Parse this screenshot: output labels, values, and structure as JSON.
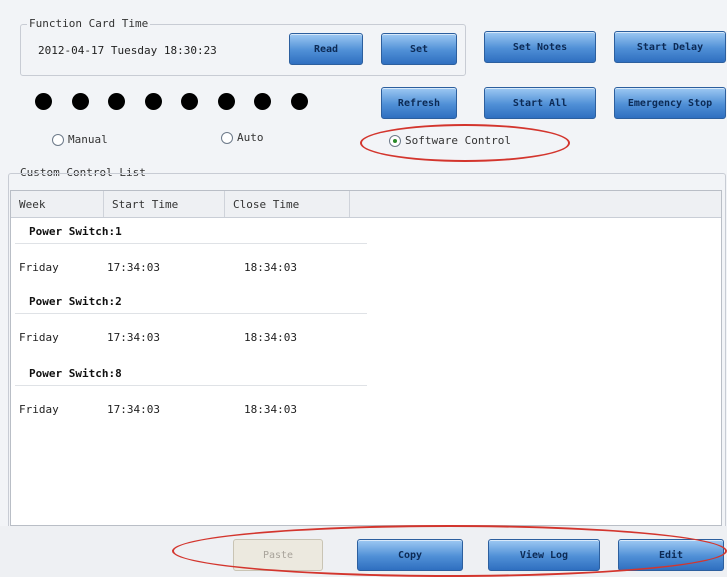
{
  "function_card_time": {
    "title": "Function Card Time",
    "datetime": "2012-04-17 Tuesday 18:30:23",
    "read_label": "Read",
    "set_label": "Set"
  },
  "toolbar": {
    "set_notes": "Set Notes",
    "start_delay": "Start Delay",
    "refresh": "Refresh",
    "start_all": "Start All",
    "emergency_stop": "Emergency Stop"
  },
  "indicators": {
    "count": 8,
    "color": "#000000"
  },
  "modes": {
    "manual": "Manual",
    "auto": "Auto",
    "software_control": "Software Control",
    "selected": "software_control"
  },
  "custom_control_list": {
    "title": "Custom Control List",
    "columns": [
      "Week",
      "Start Time",
      "Close Time"
    ],
    "groups": [
      {
        "title": "Power Switch:1",
        "rows": [
          {
            "week": "Friday",
            "start": "17:34:03",
            "close": "18:34:03"
          }
        ]
      },
      {
        "title": "Power Switch:2",
        "rows": [
          {
            "week": "Friday",
            "start": "17:34:03",
            "close": "18:34:03"
          }
        ]
      },
      {
        "title": "Power Switch:8",
        "rows": [
          {
            "week": "Friday",
            "start": "17:34:03",
            "close": "18:34:03"
          }
        ]
      }
    ]
  },
  "bottom_buttons": {
    "paste": "Paste",
    "copy": "Copy",
    "view_log": "View Log",
    "edit": "Edit"
  },
  "colors": {
    "annotation_ellipse": "#d3352d",
    "button_blue": "#4f8fd6"
  }
}
